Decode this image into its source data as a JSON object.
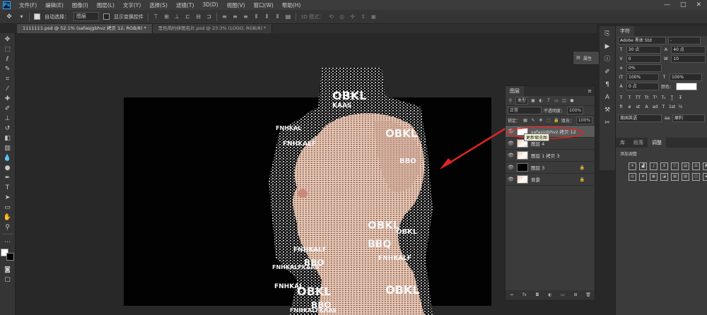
{
  "menubar": {
    "items": [
      "文件(F)",
      "编辑(E)",
      "图像(I)",
      "图层(L)",
      "文字(Y)",
      "选择(S)",
      "滤镜(T)",
      "3D(D)",
      "视图(V)",
      "窗口(W)",
      "帮助(H)"
    ],
    "window_controls": [
      "—",
      "□",
      "✕"
    ]
  },
  "optionsbar": {
    "auto_select_label": "自动选择：",
    "auto_select_value": "图层",
    "show_transform_label": "显示变换控件",
    "mode_3d_label": "3D 模式："
  },
  "tabs": [
    {
      "label": "1111111.psd @ 52.1% (safasjgbhvz 拷贝 12, RGB/8) *",
      "active": true
    },
    {
      "label": "黑色简约拼图名片.psd @ 23.3% (LOGO, RGB/8) *",
      "active": false
    }
  ],
  "layers_panel": {
    "title": "图层",
    "filter_kind": "类型",
    "blend_mode": "正常",
    "opacity_label": "不透明度：",
    "opacity_value": "100%",
    "lock_label": "锁定：",
    "fill_label": "填充：",
    "fill_value": "100%",
    "layers": [
      {
        "name": "safasjgbhvz 拷贝 12",
        "thumb": "text",
        "selected": true,
        "lock": false
      },
      {
        "name": "图层 4",
        "thumb": "img",
        "selected": false,
        "lock": false
      },
      {
        "name": "图层 1 拷贝 3",
        "thumb": "img",
        "selected": false,
        "lock": false
      },
      {
        "name": "图层 3",
        "thumb": "black",
        "selected": false,
        "lock": true
      },
      {
        "name": "背景",
        "thumb": "img",
        "selected": false,
        "lock": true
      }
    ],
    "tooltip": "更新缩览图"
  },
  "properties_popup": {
    "label": "属性"
  },
  "character_panel": {
    "title": "字符",
    "font_family": "Adobe 黑体 Std",
    "font_style": "-",
    "font_size": "30 点",
    "leading": "40 点",
    "kerning": "0",
    "tracking": "10",
    "vertical_scale_pct": "0%",
    "horizontal_scale": "100%",
    "vertical_scale": "100%",
    "baseline": "0 点",
    "color_label": "颜色：",
    "language": "美国英语",
    "antialias": "犀利"
  },
  "adjust_panel": {
    "tabs": [
      "库",
      "段落",
      "调整"
    ],
    "active_tab": "调整",
    "add_label": "添加调整"
  },
  "art": {
    "words": [
      "OBKL",
      "FNHKAL",
      "KAAS",
      "OBKL",
      "FNHKALF",
      "BBO",
      "OBKL",
      "FNHKALF",
      "FNHKALFKAAS",
      "BBO",
      "OBKL",
      "BBQ",
      "FNHKALF",
      "OBKL",
      "FNHKAL",
      "FNHKALFKAAS",
      "BBO",
      "OBKL"
    ]
  },
  "colors": {
    "accent": "#31a8ff",
    "annotation": "#e02424",
    "canvas": "#020202"
  }
}
